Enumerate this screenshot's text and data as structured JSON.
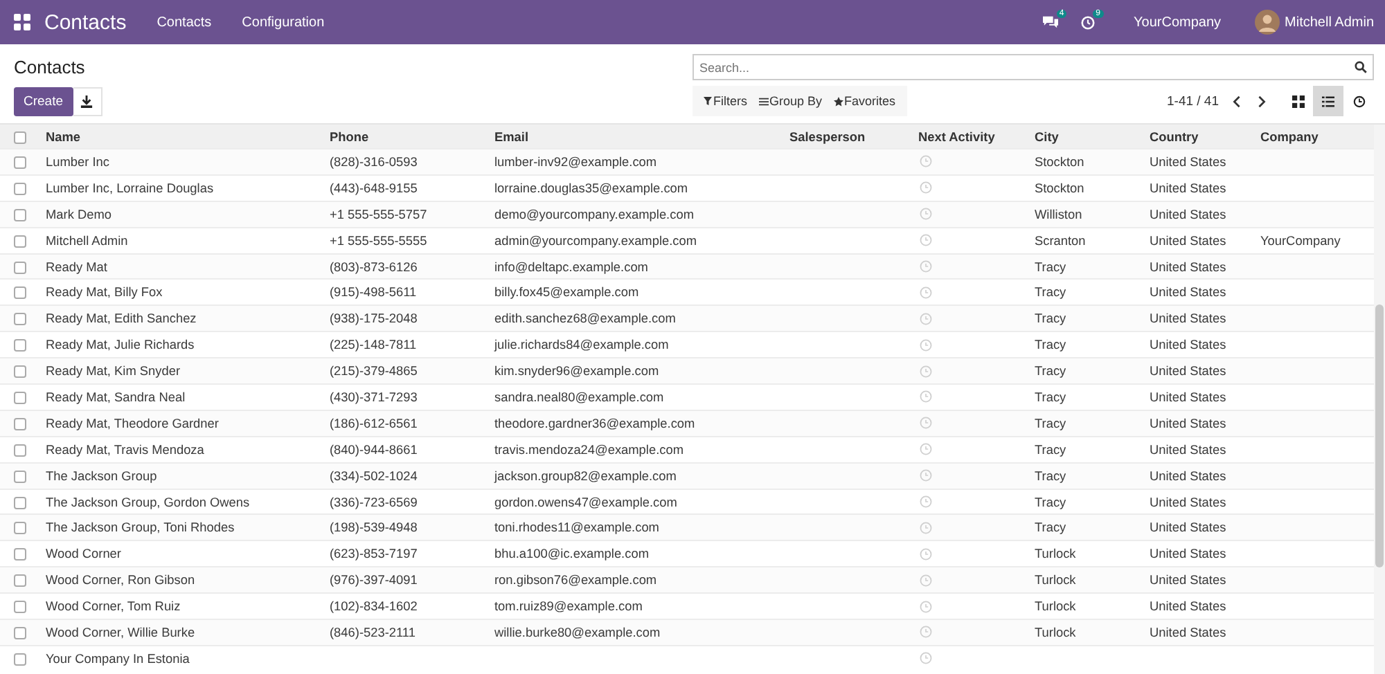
{
  "navbar": {
    "app_title": "Contacts",
    "menu": [
      "Contacts",
      "Configuration"
    ],
    "messages_badge": "4",
    "activities_badge": "9",
    "company": "YourCompany",
    "user": "Mitchell Admin"
  },
  "control_panel": {
    "title": "Contacts",
    "create_button": "Create",
    "search": {
      "placeholder": "Search..."
    },
    "filters": [
      "Filters",
      "Group By",
      "Favorites"
    ],
    "pager": "1-41 / 41",
    "views": [
      {
        "kind": "kanban",
        "selected": false
      },
      {
        "kind": "list",
        "selected": true
      },
      {
        "kind": "activity",
        "selected": false
      }
    ]
  },
  "table": {
    "select_all_checked": false,
    "columns": [
      "Name",
      "Phone",
      "Email",
      "Salesperson",
      "Next Activity",
      "City",
      "Country",
      "Company"
    ],
    "rows": [
      {
        "checked": false,
        "name": "Lumber Inc",
        "phone": "(828)-316-0593",
        "email": "lumber-inv92@example.com",
        "city": "Stockton",
        "country": "United States",
        "company": ""
      },
      {
        "checked": false,
        "name": "Lumber Inc, Lorraine Douglas",
        "phone": "(443)-648-9155",
        "email": "lorraine.douglas35@example.com",
        "city": "Stockton",
        "country": "United States",
        "company": ""
      },
      {
        "checked": false,
        "name": "Mark Demo",
        "phone": "+1 555-555-5757",
        "email": "demo@yourcompany.example.com",
        "city": "Williston",
        "country": "United States",
        "company": ""
      },
      {
        "checked": false,
        "name": "Mitchell Admin",
        "phone": "+1 555-555-5555",
        "email": "admin@yourcompany.example.com",
        "city": "Scranton",
        "country": "United States",
        "company": "YourCompany"
      },
      {
        "checked": false,
        "name": "Ready Mat",
        "phone": "(803)-873-6126",
        "email": "info@deltapc.example.com",
        "city": "Tracy",
        "country": "United States",
        "company": ""
      },
      {
        "checked": false,
        "name": "Ready Mat, Billy Fox",
        "phone": "(915)-498-5611",
        "email": "billy.fox45@example.com",
        "city": "Tracy",
        "country": "United States",
        "company": ""
      },
      {
        "checked": false,
        "name": "Ready Mat, Edith Sanchez",
        "phone": "(938)-175-2048",
        "email": "edith.sanchez68@example.com",
        "city": "Tracy",
        "country": "United States",
        "company": ""
      },
      {
        "checked": false,
        "name": "Ready Mat, Julie Richards",
        "phone": "(225)-148-7811",
        "email": "julie.richards84@example.com",
        "city": "Tracy",
        "country": "United States",
        "company": ""
      },
      {
        "checked": false,
        "name": "Ready Mat, Kim Snyder",
        "phone": "(215)-379-4865",
        "email": "kim.snyder96@example.com",
        "city": "Tracy",
        "country": "United States",
        "company": ""
      },
      {
        "checked": false,
        "name": "Ready Mat, Sandra Neal",
        "phone": "(430)-371-7293",
        "email": "sandra.neal80@example.com",
        "city": "Tracy",
        "country": "United States",
        "company": ""
      },
      {
        "checked": false,
        "name": "Ready Mat, Theodore Gardner",
        "phone": "(186)-612-6561",
        "email": "theodore.gardner36@example.com",
        "city": "Tracy",
        "country": "United States",
        "company": ""
      },
      {
        "checked": false,
        "name": "Ready Mat, Travis Mendoza",
        "phone": "(840)-944-8661",
        "email": "travis.mendoza24@example.com",
        "city": "Tracy",
        "country": "United States",
        "company": ""
      },
      {
        "checked": false,
        "name": "The Jackson Group",
        "phone": "(334)-502-1024",
        "email": "jackson.group82@example.com",
        "city": "Tracy",
        "country": "United States",
        "company": ""
      },
      {
        "checked": false,
        "name": "The Jackson Group, Gordon Owens",
        "phone": "(336)-723-6569",
        "email": "gordon.owens47@example.com",
        "city": "Tracy",
        "country": "United States",
        "company": ""
      },
      {
        "checked": false,
        "name": "The Jackson Group, Toni Rhodes",
        "phone": "(198)-539-4948",
        "email": "toni.rhodes11@example.com",
        "city": "Tracy",
        "country": "United States",
        "company": ""
      },
      {
        "checked": false,
        "name": "Wood Corner",
        "phone": "(623)-853-7197",
        "email": "bhu.a100@ic.example.com",
        "city": "Turlock",
        "country": "United States",
        "company": ""
      },
      {
        "checked": false,
        "name": "Wood Corner, Ron Gibson",
        "phone": "(976)-397-4091",
        "email": "ron.gibson76@example.com",
        "city": "Turlock",
        "country": "United States",
        "company": ""
      },
      {
        "checked": false,
        "name": "Wood Corner, Tom Ruiz",
        "phone": "(102)-834-1602",
        "email": "tom.ruiz89@example.com",
        "city": "Turlock",
        "country": "United States",
        "company": ""
      },
      {
        "checked": false,
        "name": "Wood Corner, Willie Burke",
        "phone": "(846)-523-2111",
        "email": "willie.burke80@example.com",
        "city": "Turlock",
        "country": "United States",
        "company": ""
      },
      {
        "checked": false,
        "name": "Your Company In Estonia",
        "phone": "",
        "email": "",
        "city": "",
        "country": "",
        "company": ""
      }
    ]
  }
}
